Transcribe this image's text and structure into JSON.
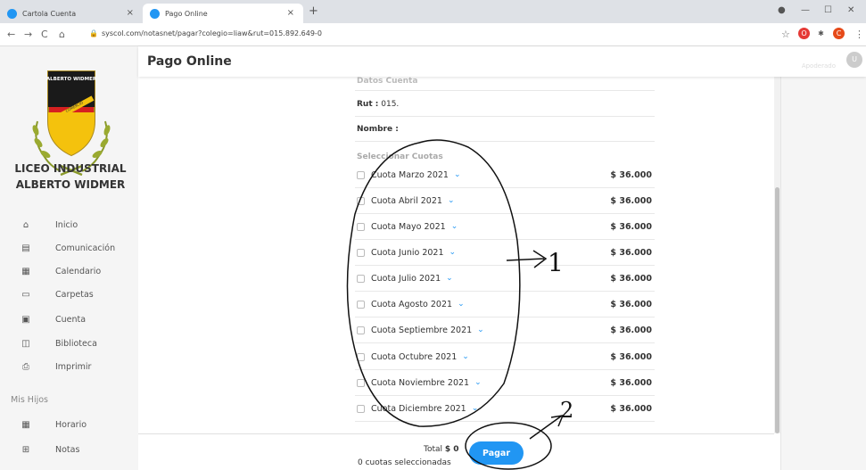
{
  "browser": {
    "tabs": [
      {
        "title": "Cartola Cuenta",
        "close": "×"
      },
      {
        "title": "Pago Online",
        "close": "×"
      }
    ],
    "new_tab": "+",
    "url": "syscol.com/notasnet/pagar?colegio=liaw&rut=015.892.649-0",
    "window_controls": {
      "minimize": "—",
      "maximize": "☐",
      "close": "✕"
    },
    "nav": {
      "back": "←",
      "forward": "→",
      "reload": "C",
      "home": "⌂"
    },
    "star": "☆",
    "extensions": [
      {
        "label": "O",
        "color": "#e53935"
      },
      {
        "label": "✱",
        "color": "#555555"
      },
      {
        "label": "C",
        "color": "#e64a19"
      }
    ],
    "menu": "⋮"
  },
  "sidebar": {
    "logo_text": "ALBERTO WIDMER",
    "logo_ribbon": "COMERCIO",
    "school_name_1": "LICEO INDUSTRIAL",
    "school_name_2": "ALBERTO WIDMER",
    "items": [
      {
        "label": "Inicio",
        "icon": "home-icon",
        "glyph": "⌂"
      },
      {
        "label": "Comunicación",
        "icon": "message-icon",
        "glyph": "▤"
      },
      {
        "label": "Calendario",
        "icon": "calendar-icon",
        "glyph": "▦"
      },
      {
        "label": "Carpetas",
        "icon": "folder-icon",
        "glyph": "▭"
      },
      {
        "label": "Cuenta",
        "icon": "account-icon",
        "glyph": "▣"
      },
      {
        "label": "Biblioteca",
        "icon": "library-icon",
        "glyph": "◫"
      },
      {
        "label": "Imprimir",
        "icon": "print-icon",
        "glyph": "⎙"
      }
    ],
    "section_mis_hijos": "Mis Hijos",
    "child_items": [
      {
        "label": "Horario",
        "icon": "schedule-icon",
        "glyph": "▦"
      },
      {
        "label": "Notas",
        "icon": "grades-icon",
        "glyph": "⊞"
      }
    ]
  },
  "header": {
    "title": "Pago Online",
    "role": "Apoderado",
    "avatar": "U"
  },
  "account": {
    "section_title": "Datos Cuenta",
    "rut_label": "Rut :",
    "rut_value": "015.",
    "name_label": "Nombre :",
    "name_value": ""
  },
  "cuotas": {
    "section_label": "Seleccionar Cuotas",
    "items": [
      {
        "label": "Cuota Marzo 2021",
        "amount": "$ 36.000"
      },
      {
        "label": "Cuota Abril 2021",
        "amount": "$ 36.000"
      },
      {
        "label": "Cuota Mayo 2021",
        "amount": "$ 36.000"
      },
      {
        "label": "Cuota Junio 2021",
        "amount": "$ 36.000"
      },
      {
        "label": "Cuota Julio 2021",
        "amount": "$ 36.000"
      },
      {
        "label": "Cuota Agosto 2021",
        "amount": "$ 36.000"
      },
      {
        "label": "Cuota Septiembre 2021",
        "amount": "$ 36.000"
      },
      {
        "label": "Cuota Octubre 2021",
        "amount": "$ 36.000"
      },
      {
        "label": "Cuota Noviembre 2021",
        "amount": "$ 36.000"
      },
      {
        "label": "Cuota Diciembre 2021",
        "amount": "$ 36.000"
      }
    ],
    "chevron": "⌄"
  },
  "footer": {
    "total_label": "Total",
    "total_value": "$ 0",
    "selected_count": "0 cuotas seleccionadas",
    "pay_button": "Pagar"
  },
  "annotations": {
    "arrow_1_label": "1",
    "arrow_2_label": "2"
  },
  "colors": {
    "accent": "#2196f3",
    "sidebar_bg": "#f5f5f5"
  }
}
